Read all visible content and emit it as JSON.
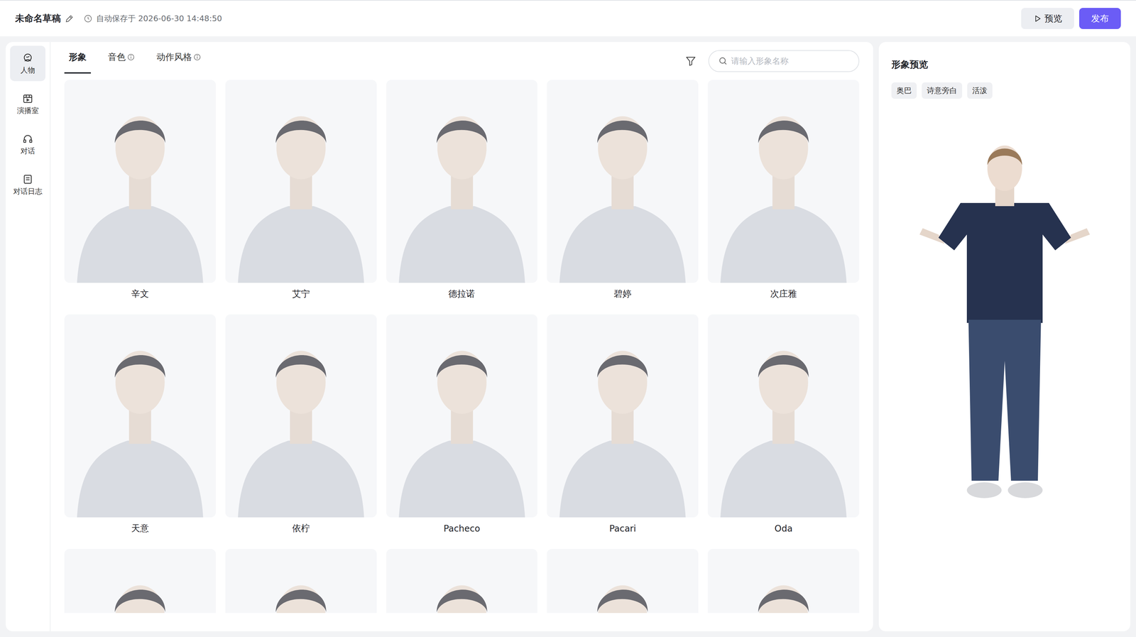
{
  "draft": {
    "title": "未命名草稿",
    "autosave": "自动保存于 2026-06-30 14:48:50"
  },
  "actions": [
    {
      "label": "预览",
      "kind": "secondary"
    },
    {
      "label": "发布",
      "kind": "primary"
    }
  ],
  "sidebar": {
    "items": [
      {
        "label": "人物",
        "selected": true
      },
      {
        "label": "演播室",
        "selected": false
      },
      {
        "label": "对话",
        "selected": false
      },
      {
        "label": "对话日志",
        "selected": false
      }
    ]
  },
  "tabs": [
    {
      "label": "形象",
      "selected": true,
      "info": false
    },
    {
      "label": "音色",
      "selected": false,
      "info": true
    },
    {
      "label": "动作风格",
      "selected": false,
      "info": true
    }
  ],
  "search": {
    "placeholder": "请输入形象名称"
  },
  "avatars": [
    {
      "name": "辛文",
      "cut": false
    },
    {
      "name": "艾宁",
      "cut": false
    },
    {
      "name": "德拉诺",
      "cut": false
    },
    {
      "name": "碧婷",
      "cut": false
    },
    {
      "name": "次庄雅",
      "cut": false
    },
    {
      "name": "天意",
      "cut": false
    },
    {
      "name": "依柠",
      "cut": false
    },
    {
      "name": "Pacheco",
      "cut": false
    },
    {
      "name": "Pacari",
      "cut": false
    },
    {
      "name": "Oda",
      "cut": false
    },
    {
      "cut": true
    },
    {
      "cut": true
    },
    {
      "cut": true
    },
    {
      "cut": true
    },
    {
      "cut": true
    }
  ],
  "preview": {
    "title": "形象预览",
    "tags": [
      "奥巴",
      "诗意旁白",
      "活泼"
    ]
  }
}
